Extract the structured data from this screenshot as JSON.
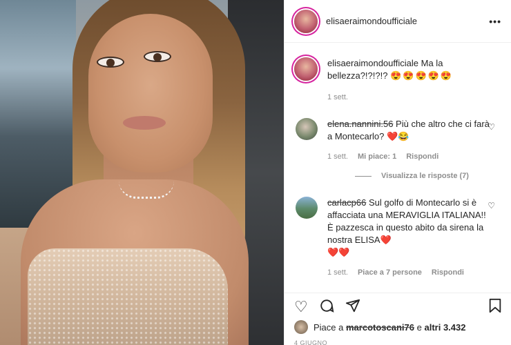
{
  "post": {
    "username": "elisaeraimondoufficiale",
    "more_icon": "more-horizontal-icon"
  },
  "caption": {
    "username": "elisaeraimondoufficiale",
    "text": "Ma la bellezza?!?!?!?",
    "emojis": "😍😍😍😍😍",
    "time": "1 sett."
  },
  "comments": [
    {
      "username": "elena.nannini.56",
      "text": "Più che altro che ci farà a Montecarlo?",
      "emojis": "❤️😂",
      "time": "1 sett.",
      "likes": "Mi piace: 1",
      "reply": "Rispondi",
      "view_replies": "Visualizza le risposte (7)"
    },
    {
      "username": "carlacp66",
      "text": "Sul golfo di Montecarlo si è affacciata una MERAVIGLIA ITALIANA!! È pazzesca in questo abito da sirena la nostra ELISA",
      "emojis_inline": "❤️",
      "emojis": "❤️❤️",
      "time": "1 sett.",
      "likes": "Piace a 7 persone",
      "reply": "Rispondi"
    }
  ],
  "actions": {
    "like_icon": "heart-icon",
    "comment_icon": "comment-icon",
    "share_icon": "send-icon",
    "save_icon": "bookmark-icon"
  },
  "likes": {
    "prefix": "Piace a",
    "user": "marcotoscani76",
    "suffix": "e",
    "others": "altri 3.432"
  },
  "date": "4 GIUGNO"
}
